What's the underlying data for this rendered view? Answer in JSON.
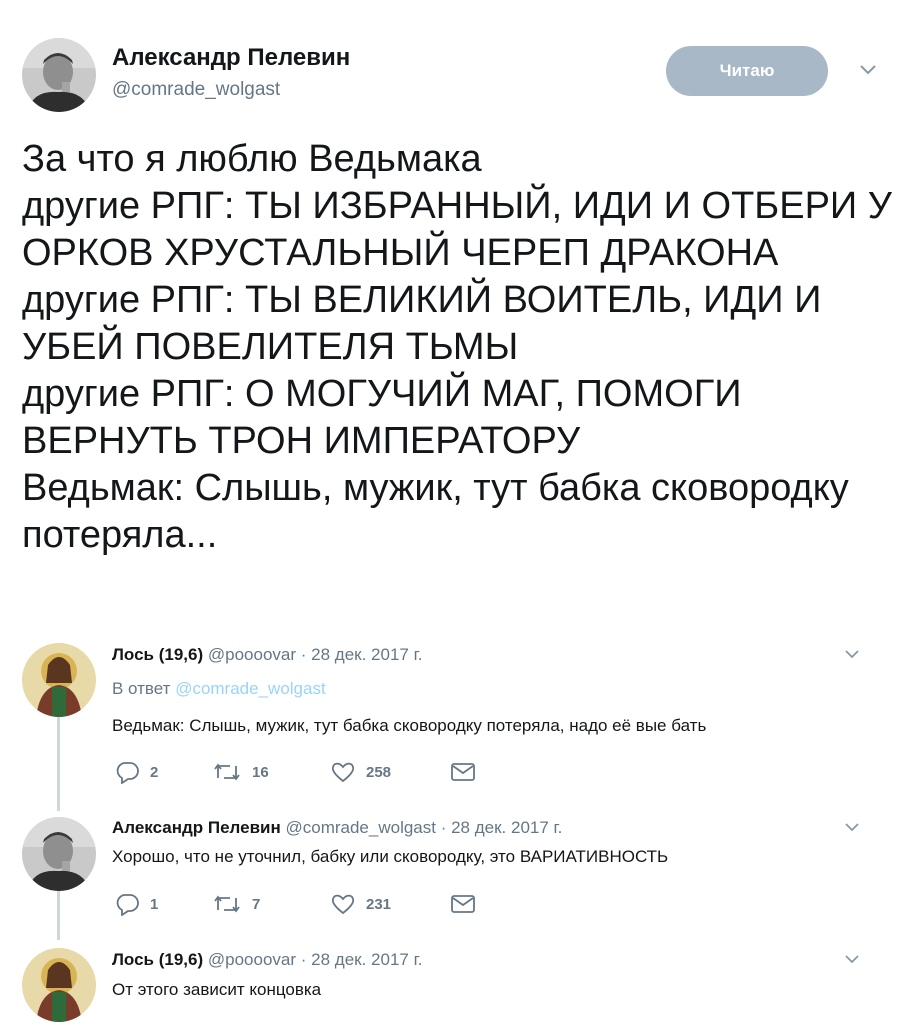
{
  "main_tweet": {
    "author_name": "Александр Пелевин",
    "author_handle": "@comrade_wolgast",
    "follow_label": "Читаю",
    "text": "За что я люблю Ведьмака\nдругие РПГ: ТЫ ИЗБРАННЫЙ, ИДИ И ОТБЕРИ У ОРКОВ ХРУСТАЛЬНЫЙ ЧЕРЕП ДРАКОНА\nдругие РПГ: ТЫ ВЕЛИКИЙ ВОИТЕЛЬ, ИДИ И УБЕЙ ПОВЕЛИТЕЛЯ ТЬМЫ\nдругие РПГ: О МОГУЧИЙ МАГ, ПОМОГИ ВЕРНУТЬ ТРОН ИМПЕРАТОРУ\nВедьмак: Слышь, мужик, тут бабка сковородку потеряла..."
  },
  "replies": [
    {
      "name": "Лось (19,6)",
      "handle": "@poooovar",
      "date": "· 28 дек. 2017 г.",
      "reply_to_prefix": "В ответ",
      "reply_to_handle": "@comrade_wolgast",
      "text": "Ведьмак: Слышь, мужик, тут бабка сковородку потеряла, надо её вые бать",
      "replies_count": "2",
      "retweets_count": "16",
      "likes_count": "258"
    },
    {
      "name": "Александр Пелевин",
      "handle": "@comrade_wolgast",
      "date": "· 28 дек. 2017 г.",
      "text": "Хорошо, что не уточнил, бабку или сковородку, это ВАРИАТИВНОСТЬ",
      "replies_count": "1",
      "retweets_count": "7",
      "likes_count": "231"
    },
    {
      "name": "Лось (19,6)",
      "handle": "@poooovar",
      "date": "· 28 дек. 2017 г.",
      "text": "От этого зависит концовка"
    }
  ],
  "icons": {
    "reply": "reply-icon",
    "retweet": "retweet-icon",
    "like": "heart-icon",
    "dm": "envelope-icon",
    "more": "chevron-down-icon"
  },
  "colors": {
    "follow_button": "#a8b8c6",
    "secondary_text": "#657786",
    "link": "#1da1f2",
    "thread_line": "#ccd6dd"
  }
}
